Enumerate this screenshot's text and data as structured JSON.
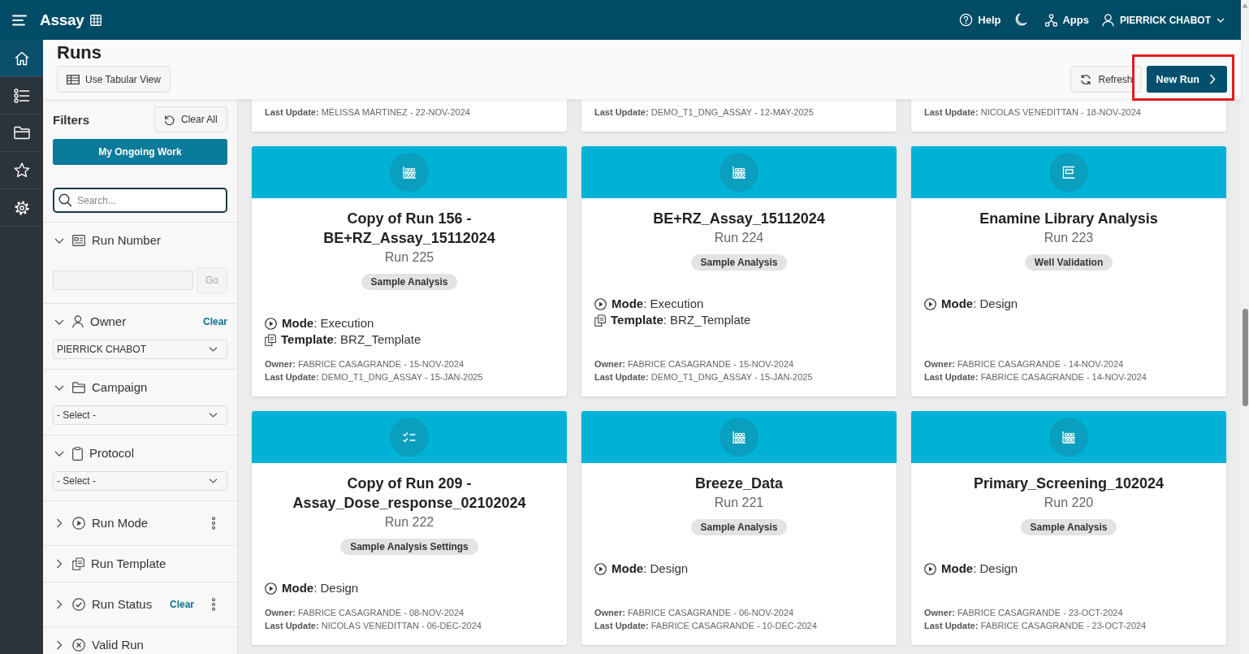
{
  "top_bar": {
    "app_name": "Assay",
    "help": "Help",
    "apps": "Apps",
    "user": "PIERRICK CHABOT"
  },
  "nav_rail": [
    {
      "selected": true
    },
    {
      "selected": false
    },
    {
      "selected": false
    },
    {
      "selected": false
    },
    {
      "selected": false
    }
  ],
  "header": {
    "title": "Runs",
    "tabular_view_button": "Use Tabular View",
    "refresh_button": "Refresh",
    "new_run_button": {
      "label": "New Run",
      "highlighted": true
    }
  },
  "filters": {
    "title": "Filters",
    "clear_all_button": "Clear All",
    "ongoing_work_button": "My Ongoing Work",
    "search": {
      "placeholder": "Search..."
    },
    "sections": [
      {
        "label": "Run Number",
        "expanded": true,
        "kind": "number",
        "go_button": {
          "label": "Go",
          "disabled": true
        },
        "menu": false
      },
      {
        "label": "Owner",
        "expanded": true,
        "kind": "select",
        "clear": "Clear",
        "value": "PIERRICK CHABOT",
        "menu": false
      },
      {
        "label": "Campaign",
        "expanded": true,
        "kind": "select",
        "value": "- Select -",
        "menu": false
      },
      {
        "label": "Protocol",
        "expanded": true,
        "kind": "select",
        "value": "- Select -",
        "menu": false
      },
      {
        "label": "Run Mode",
        "expanded": false,
        "menu": true
      },
      {
        "label": "Run Template",
        "expanded": false,
        "menu": false
      },
      {
        "label": "Run Status",
        "expanded": false,
        "clear": "Clear",
        "menu": true
      },
      {
        "label": "Valid Run",
        "expanded": false,
        "menu": false
      }
    ]
  },
  "partial_cards": [
    {
      "last_update": "**Last Update:** MÉLISSA MARTINEZ - 22-NOV-2024"
    },
    {
      "last_update": "**Last Update:** DEMO_T1_DNG_ASSAY - 12-MAY-2025"
    },
    {
      "last_update": "**Last Update:** NICOLAS VENEDITTAN - 18-NOV-2024"
    }
  ],
  "cards": [
    {
      "kind": "analysis",
      "title": "Copy of Run 156 - BE+RZ_Assay_15112024",
      "run": "Run 225",
      "tag": "Sample Analysis",
      "mode": "**Mode**: Execution",
      "template": "**Template**: BRZ_Template",
      "owner": "**Owner:** FABRICE CASAGRANDE - 15-NOV-2024",
      "last_update": "**Last Update:** DEMO_T1_DNG_ASSAY - 15-JAN-2025"
    },
    {
      "kind": "analysis",
      "title": "BE+RZ_Assay_15112024",
      "run": "Run 224",
      "tag": "Sample Analysis",
      "mode": "**Mode**: Execution",
      "template": "**Template**: BRZ_Template",
      "owner": "**Owner:** FABRICE CASAGRANDE - 15-NOV-2024",
      "last_update": "**Last Update:** DEMO_T1_DNG_ASSAY - 15-JAN-2025"
    },
    {
      "kind": "validation",
      "title": "Enamine Library Analysis",
      "run": "Run 223",
      "tag": "Well Validation",
      "mode": "**Mode**: Design",
      "owner": "**Owner:** FABRICE CASAGRANDE - 14-NOV-2024",
      "last_update": "**Last Update:** FABRICE CASAGRANDE - 14-NOV-2024"
    },
    {
      "kind": "settings",
      "title": "Copy of Run 209 - Assay_Dose_response_02102024",
      "run": "Run 222",
      "tag": "Sample Analysis Settings",
      "mode": "**Mode**: Design",
      "owner": "**Owner:** FABRICE CASAGRANDE - 08-NOV-2024",
      "last_update": "**Last Update:** NICOLAS VENEDITTAN - 06-DEC-2024"
    },
    {
      "kind": "analysis",
      "title": "Breeze_Data",
      "run": "Run 221",
      "tag": "Sample Analysis",
      "mode": "**Mode**: Design",
      "owner": "**Owner:** FABRICE CASAGRANDE - 06-NOV-2024",
      "last_update": "**Last Update:** FABRICE CASAGRANDE - 10-DEC-2024"
    },
    {
      "kind": "analysis",
      "title": "Primary_Screening_102024",
      "run": "Run 220",
      "tag": "Sample Analysis",
      "mode": "**Mode**: Design",
      "owner": "**Owner:** FABRICE CASAGRANDE - 23-OCT-2024",
      "last_update": "**Last Update:** FABRICE CASAGRANDE - 23-OCT-2024"
    }
  ]
}
